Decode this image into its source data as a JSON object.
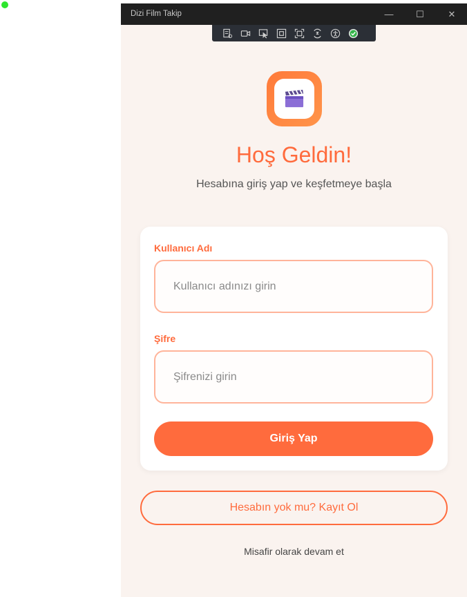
{
  "window": {
    "title": "Dizi Film Takip",
    "minimize_glyph": "—",
    "maximize_glyph": "☐",
    "close_glyph": "✕"
  },
  "devtools": {
    "tools": [
      "live-visual-tree-icon",
      "record-icon",
      "select-element-icon",
      "display-layout-adorners-icon",
      "track-focus-icon",
      "hot-reload-icon",
      "accessibility-icon",
      "binding-check-icon"
    ]
  },
  "app": {
    "logo_icon": "clapperboard-icon",
    "heading": "Hoş Geldin!",
    "subheading": "Hesabına giriş yap ve keşfetmeye başla",
    "username_label": "Kullanıcı Adı",
    "username_placeholder": "Kullanıcı adınızı girin",
    "password_label": "Şifre",
    "password_placeholder": "Şifrenizi girin",
    "login_button": "Giriş Yap",
    "register_button": "Hesabın yok mu? Kayıt Ol",
    "guest_link": "Misafir olarak devam et"
  },
  "colors": {
    "accent": "#ff6b3d",
    "background": "#faf3ef",
    "field_border": "#ffb49a",
    "titlebar": "#202020"
  }
}
